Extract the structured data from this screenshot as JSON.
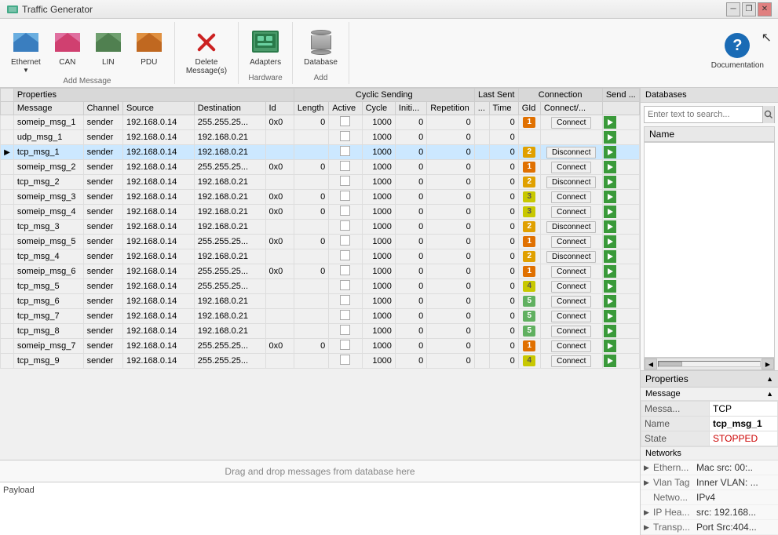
{
  "titleBar": {
    "title": "Traffic Generator",
    "buttons": [
      "minimize",
      "restore",
      "close"
    ]
  },
  "toolbar": {
    "groups": [
      {
        "id": "add-message",
        "label": "Add Message",
        "items": [
          {
            "id": "ethernet",
            "label": "Ethernet",
            "sublabel": "",
            "icon": "envelope-blue"
          },
          {
            "id": "can",
            "label": "CAN",
            "sublabel": "",
            "icon": "envelope-pink"
          },
          {
            "id": "lin",
            "label": "LIN",
            "sublabel": "",
            "icon": "envelope-green"
          },
          {
            "id": "pdu",
            "label": "PDU",
            "sublabel": "",
            "icon": "envelope-orange"
          }
        ]
      },
      {
        "id": "delete",
        "label": "",
        "items": [
          {
            "id": "delete-messages",
            "label": "Delete",
            "sublabel": "Message(s)",
            "icon": "delete-x"
          }
        ]
      },
      {
        "id": "hardware",
        "label": "Hardware",
        "items": [
          {
            "id": "adapters",
            "label": "Adapters",
            "sublabel": "",
            "icon": "adapters"
          }
        ]
      },
      {
        "id": "add-db",
        "label": "Add",
        "items": [
          {
            "id": "database",
            "label": "Database",
            "sublabel": "",
            "icon": "database"
          }
        ]
      }
    ],
    "helpBtn": {
      "label": "Documentation",
      "icon": "help"
    }
  },
  "table": {
    "groupHeaders": [
      {
        "label": "",
        "colspan": 1
      },
      {
        "label": "Properties",
        "colspan": 5
      },
      {
        "label": "Cyclic Sending",
        "colspan": 5
      },
      {
        "label": "Last Sent",
        "colspan": 2
      },
      {
        "label": "Connection",
        "colspan": 2
      },
      {
        "label": "Send ...",
        "colspan": 1
      }
    ],
    "headers": [
      "",
      "Message",
      "Channel",
      "Source",
      "Destination",
      "Id",
      "Length",
      "Active",
      "Cycle",
      "Initi...",
      "Repetition",
      "...",
      "Time",
      "GId",
      "Connect/...",
      ""
    ],
    "rows": [
      {
        "id": "someip_msg_1",
        "channel": "sender",
        "src": "192.168.0.14",
        "dst": "255.255.25...",
        "msgId": "0x0",
        "len": "0",
        "active": false,
        "cycle": "1000",
        "init": "0",
        "rep": "0",
        "dots": "",
        "time": "0",
        "gid": "1",
        "gidClass": "gid-1",
        "connLabel": "Connect",
        "connType": "connect",
        "selected": false
      },
      {
        "id": "udp_msg_1",
        "channel": "sender",
        "src": "192.168.0.14",
        "dst": "192.168.0.21",
        "msgId": "",
        "len": "",
        "active": false,
        "cycle": "1000",
        "init": "0",
        "rep": "0",
        "dots": "",
        "time": "0",
        "gid": "",
        "gidClass": "",
        "connLabel": "",
        "connType": "",
        "selected": false
      },
      {
        "id": "tcp_msg_1",
        "channel": "sender",
        "src": "192.168.0.14",
        "dst": "192.168.0.21",
        "msgId": "",
        "len": "",
        "active": false,
        "cycle": "1000",
        "init": "0",
        "rep": "0",
        "dots": "",
        "time": "0",
        "gid": "2",
        "gidClass": "gid-2",
        "connLabel": "Disconnect",
        "connType": "disconnect",
        "selected": true
      },
      {
        "id": "someip_msg_2",
        "channel": "sender",
        "src": "192.168.0.14",
        "dst": "255.255.25...",
        "msgId": "0x0",
        "len": "0",
        "active": false,
        "cycle": "1000",
        "init": "0",
        "rep": "0",
        "dots": "",
        "time": "0",
        "gid": "1",
        "gidClass": "gid-1",
        "connLabel": "Connect",
        "connType": "connect",
        "selected": false
      },
      {
        "id": "tcp_msg_2",
        "channel": "sender",
        "src": "192.168.0.14",
        "dst": "192.168.0.21",
        "msgId": "",
        "len": "",
        "active": false,
        "cycle": "1000",
        "init": "0",
        "rep": "0",
        "dots": "",
        "time": "0",
        "gid": "2",
        "gidClass": "gid-2",
        "connLabel": "Disconnect",
        "connType": "disconnect",
        "selected": false
      },
      {
        "id": "someip_msg_3",
        "channel": "sender",
        "src": "192.168.0.14",
        "dst": "192.168.0.21",
        "msgId": "0x0",
        "len": "0",
        "active": false,
        "cycle": "1000",
        "init": "0",
        "rep": "0",
        "dots": "",
        "time": "0",
        "gid": "3",
        "gidClass": "gid-3",
        "connLabel": "Connect",
        "connType": "connect",
        "selected": false
      },
      {
        "id": "someip_msg_4",
        "channel": "sender",
        "src": "192.168.0.14",
        "dst": "192.168.0.21",
        "msgId": "0x0",
        "len": "0",
        "active": false,
        "cycle": "1000",
        "init": "0",
        "rep": "0",
        "dots": "",
        "time": "0",
        "gid": "3",
        "gidClass": "gid-3",
        "connLabel": "Connect",
        "connType": "connect",
        "selected": false
      },
      {
        "id": "tcp_msg_3",
        "channel": "sender",
        "src": "192.168.0.14",
        "dst": "192.168.0.21",
        "msgId": "",
        "len": "",
        "active": false,
        "cycle": "1000",
        "init": "0",
        "rep": "0",
        "dots": "",
        "time": "0",
        "gid": "2",
        "gidClass": "gid-2",
        "connLabel": "Disconnect",
        "connType": "disconnect",
        "selected": false
      },
      {
        "id": "someip_msg_5",
        "channel": "sender",
        "src": "192.168.0.14",
        "dst": "255.255.25...",
        "msgId": "0x0",
        "len": "0",
        "active": false,
        "cycle": "1000",
        "init": "0",
        "rep": "0",
        "dots": "",
        "time": "0",
        "gid": "1",
        "gidClass": "gid-1",
        "connLabel": "Connect",
        "connType": "connect",
        "selected": false
      },
      {
        "id": "tcp_msg_4",
        "channel": "sender",
        "src": "192.168.0.14",
        "dst": "192.168.0.21",
        "msgId": "",
        "len": "",
        "active": false,
        "cycle": "1000",
        "init": "0",
        "rep": "0",
        "dots": "",
        "time": "0",
        "gid": "2",
        "gidClass": "gid-2",
        "connLabel": "Disconnect",
        "connType": "disconnect",
        "selected": false
      },
      {
        "id": "someip_msg_6",
        "channel": "sender",
        "src": "192.168.0.14",
        "dst": "255.255.25...",
        "msgId": "0x0",
        "len": "0",
        "active": false,
        "cycle": "1000",
        "init": "0",
        "rep": "0",
        "dots": "",
        "time": "0",
        "gid": "1",
        "gidClass": "gid-1",
        "connLabel": "Connect",
        "connType": "connect",
        "selected": false
      },
      {
        "id": "tcp_msg_5",
        "channel": "sender",
        "src": "192.168.0.14",
        "dst": "255.255.25...",
        "msgId": "",
        "len": "",
        "active": false,
        "cycle": "1000",
        "init": "0",
        "rep": "0",
        "dots": "",
        "time": "0",
        "gid": "4",
        "gidClass": "gid-4",
        "connLabel": "Connect",
        "connType": "connect",
        "selected": false
      },
      {
        "id": "tcp_msg_6",
        "channel": "sender",
        "src": "192.168.0.14",
        "dst": "192.168.0.21",
        "msgId": "",
        "len": "",
        "active": false,
        "cycle": "1000",
        "init": "0",
        "rep": "0",
        "dots": "",
        "time": "0",
        "gid": "5",
        "gidClass": "gid-5",
        "connLabel": "Connect",
        "connType": "connect",
        "selected": false
      },
      {
        "id": "tcp_msg_7",
        "channel": "sender",
        "src": "192.168.0.14",
        "dst": "192.168.0.21",
        "msgId": "",
        "len": "",
        "active": false,
        "cycle": "1000",
        "init": "0",
        "rep": "0",
        "dots": "",
        "time": "0",
        "gid": "5",
        "gidClass": "gid-5",
        "connLabel": "Connect",
        "connType": "connect",
        "selected": false
      },
      {
        "id": "tcp_msg_8",
        "channel": "sender",
        "src": "192.168.0.14",
        "dst": "192.168.0.21",
        "msgId": "",
        "len": "",
        "active": false,
        "cycle": "1000",
        "init": "0",
        "rep": "0",
        "dots": "",
        "time": "0",
        "gid": "5",
        "gidClass": "gid-5",
        "connLabel": "Connect",
        "connType": "connect",
        "selected": false
      },
      {
        "id": "someip_msg_7",
        "channel": "sender",
        "src": "192.168.0.14",
        "dst": "255.255.25...",
        "msgId": "0x0",
        "len": "0",
        "active": false,
        "cycle": "1000",
        "init": "0",
        "rep": "0",
        "dots": "",
        "time": "0",
        "gid": "1",
        "gidClass": "gid-1",
        "connLabel": "Connect",
        "connType": "connect",
        "selected": false
      },
      {
        "id": "tcp_msg_9",
        "channel": "sender",
        "src": "192.168.0.14",
        "dst": "255.255.25...",
        "msgId": "",
        "len": "",
        "active": false,
        "cycle": "1000",
        "init": "0",
        "rep": "0",
        "dots": "",
        "time": "0",
        "gid": "4",
        "gidClass": "gid-4",
        "connLabel": "Connect",
        "connType": "connect",
        "selected": false
      }
    ]
  },
  "dragDrop": {
    "label": "Drag and drop messages from database here"
  },
  "payload": {
    "label": "Payload"
  },
  "rightPanel": {
    "databases": {
      "title": "Databases",
      "search": {
        "placeholder": "Enter text to search...",
        "value": ""
      },
      "columns": [
        "Name"
      ]
    },
    "properties": {
      "title": "Properties",
      "message": {
        "label": "Message",
        "fields": [
          {
            "label": "Messa...",
            "value": "TCP"
          },
          {
            "label": "Name",
            "value": "tcp_msg_1"
          },
          {
            "label": "State",
            "value": "STOPPED"
          }
        ]
      },
      "networks": {
        "label": "Networks",
        "items": [
          {
            "expand": true,
            "label": "Ethern...",
            "value": "Mac src: 00:.."
          },
          {
            "expand": true,
            "label": "Vlan Tag",
            "value": "Inner VLAN: ..."
          },
          {
            "expand": false,
            "label": "Netwo...",
            "value": "IPv4"
          },
          {
            "expand": true,
            "label": "IP Hea...",
            "value": "src: 192.168..."
          },
          {
            "expand": true,
            "label": "Transp...",
            "value": "Port Src:404..."
          }
        ]
      }
    }
  }
}
